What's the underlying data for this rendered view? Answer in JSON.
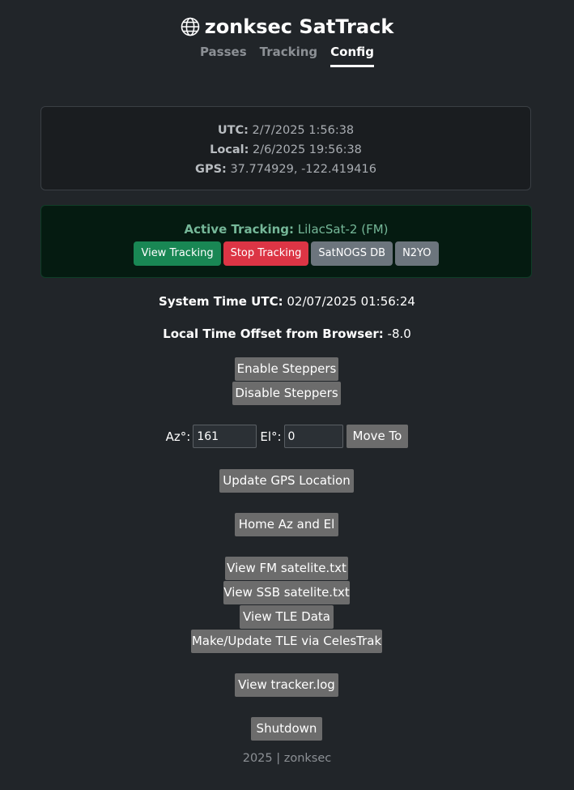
{
  "header": {
    "icon": "globe-icon",
    "title": "zonksec SatTrack"
  },
  "nav": {
    "tabs": [
      {
        "label": "Passes",
        "active": false
      },
      {
        "label": "Tracking",
        "active": false
      },
      {
        "label": "Config",
        "active": true
      }
    ]
  },
  "time_card": {
    "utc_label": "UTC:",
    "utc_value": "2/7/2025 1:56:38",
    "local_label": "Local:",
    "local_value": "2/6/2025 19:56:38",
    "gps_label": "GPS:",
    "gps_value": "37.774929, -122.419416"
  },
  "tracking": {
    "label": "Active Tracking:",
    "satellite": "LilacSat-2 (FM)",
    "buttons": {
      "view": "View Tracking",
      "stop": "Stop Tracking",
      "satnogs": "SatNOGS DB",
      "n2yo": "N2YO"
    }
  },
  "system": {
    "time_label": "System Time UTC:",
    "time_value": "02/07/2025 01:56:24",
    "offset_label": "Local Time Offset from Browser:",
    "offset_value": "-8.0"
  },
  "controls": {
    "enable_steppers": "Enable Steppers",
    "disable_steppers": "Disable Steppers",
    "az_label": "Az°:",
    "az_value": "161",
    "el_label": "El°:",
    "el_value": "0",
    "move_to": "Move To",
    "update_gps": "Update GPS Location",
    "home": "Home Az and El",
    "view_fm": "View FM satelite.txt",
    "view_ssb": "View SSB satelite.txt",
    "view_tle": "View TLE Data",
    "update_tle": "Make/Update TLE via CelesTrak",
    "view_log": "View tracker.log",
    "shutdown": "Shutdown"
  },
  "footer": {
    "text": "2025 | zonksec"
  },
  "colors": {
    "background": "#212529",
    "success": "#198754",
    "danger": "#dc3545",
    "secondary": "#6c757d",
    "tracking_text": "#75b798"
  }
}
